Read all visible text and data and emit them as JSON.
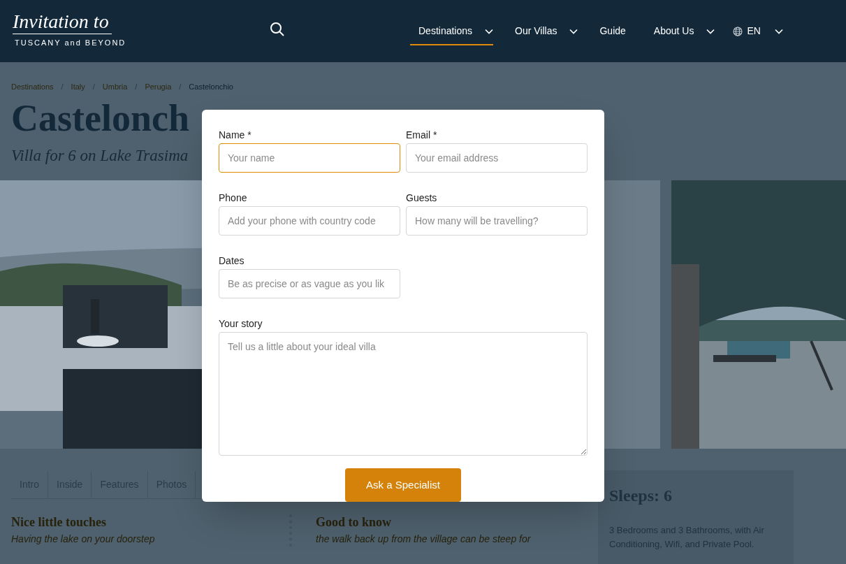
{
  "header": {
    "logo": {
      "script": "Invitation to",
      "tagline": "TUSCANY and BEYOND"
    },
    "nav": [
      {
        "label": "Destinations",
        "selected": true,
        "has_menu": true
      },
      {
        "label": "Our Villas",
        "selected": false,
        "has_menu": true
      },
      {
        "label": "Guide",
        "selected": false,
        "has_menu": false
      },
      {
        "label": "About Us",
        "selected": false,
        "has_menu": true
      }
    ],
    "language": {
      "label": "EN",
      "has_menu": true
    }
  },
  "breadcrumb": [
    {
      "label": "Destinations",
      "current": false
    },
    {
      "separator": "/",
      "label": "Italy",
      "current": false
    },
    {
      "separator": "/",
      "label": "Umbria",
      "current": false
    },
    {
      "separator": "/",
      "label": "Perugia",
      "current": false
    },
    {
      "separator": "/",
      "label": "Castelonchio",
      "current": true
    }
  ],
  "title": "Castelonch",
  "subtitle": "Villa for 6 on Lake Trasima",
  "tabs": [
    {
      "label": "Intro",
      "selected": false
    },
    {
      "label": "Inside",
      "selected": false
    },
    {
      "label": "Features",
      "selected": false
    },
    {
      "label": "Photos",
      "selected": false
    }
  ],
  "sections": [
    {
      "heading": "Nice little touches",
      "text": "Having the lake on your doorstep"
    },
    {
      "heading": "Good to know",
      "text": "the walk back up from the village can be steep for"
    }
  ],
  "summary": {
    "title": "Sleeps: 6",
    "text": "3 Bedrooms and 3 Bathrooms, with Air Conditioning, Wifi, and Private Pool."
  },
  "modal": {
    "fields": [
      {
        "kind": "input",
        "label": "Name *",
        "placeholder": "Your name",
        "focused": true
      },
      {
        "kind": "input",
        "label": "Email *",
        "placeholder": "Your email address",
        "focused": false
      },
      {
        "kind": "input",
        "label": "Phone",
        "placeholder": "Add your phone with country code",
        "focused": false
      },
      {
        "kind": "input",
        "label": "Guests",
        "placeholder": "How many will be travelling?",
        "focused": false
      },
      {
        "kind": "input",
        "label": "Dates",
        "placeholder": "Be as precise or as vague as you lik",
        "focused": false
      },
      {
        "kind": "textarea",
        "label": "Your story",
        "placeholder": "Tell us a little about your ideal villa",
        "focused": false
      }
    ],
    "button": "Ask a Specialist"
  }
}
